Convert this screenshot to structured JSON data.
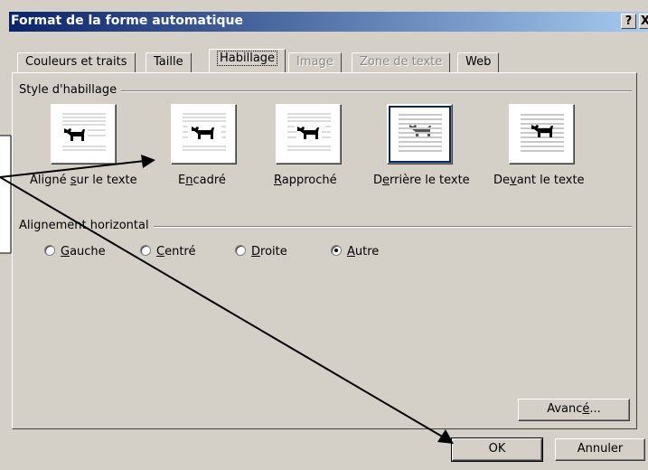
{
  "window": {
    "title": "Format de la forme automatique",
    "help_label": "?",
    "close_label": "X"
  },
  "tabs": [
    {
      "label": "Couleurs et traits",
      "state": "normal"
    },
    {
      "label": "Taille",
      "state": "normal"
    },
    {
      "label": "Habillage",
      "state": "active"
    },
    {
      "label": "Image",
      "state": "disabled"
    },
    {
      "label": "Zone de texte",
      "state": "disabled"
    },
    {
      "label": "Web",
      "state": "normal"
    }
  ],
  "wrap_style": {
    "group_label": "Style d'habillage",
    "options": [
      {
        "pre": "Aligné ",
        "u": "s",
        "post": "ur le texte",
        "icon": "inline-with-text-icon",
        "selected": false
      },
      {
        "pre": "E",
        "u": "n",
        "post": "cadré",
        "icon": "square-wrap-icon",
        "selected": false
      },
      {
        "pre": "",
        "u": "R",
        "post": "approché",
        "icon": "tight-wrap-icon",
        "selected": false
      },
      {
        "pre": "D",
        "u": "e",
        "post": "rrière le texte",
        "icon": "behind-text-icon",
        "selected": true
      },
      {
        "pre": "De",
        "u": "v",
        "post": "ant le texte",
        "icon": "in-front-of-text-icon",
        "selected": false
      }
    ]
  },
  "horizontal_alignment": {
    "group_label": "Alignement horizontal",
    "options": [
      {
        "pre": "",
        "u": "G",
        "post": "auche",
        "checked": false
      },
      {
        "pre": "",
        "u": "C",
        "post": "entré",
        "checked": false
      },
      {
        "pre": "",
        "u": "D",
        "post": "roite",
        "checked": false
      },
      {
        "pre": "",
        "u": "A",
        "post": "utre",
        "checked": true
      }
    ]
  },
  "buttons": {
    "advanced": {
      "pre": "Avanc",
      "u": "é",
      "post": "..."
    },
    "ok": "OK",
    "cancel": "Annuler"
  },
  "colors": {
    "title_gradient_start": "#0a246a",
    "title_gradient_end": "#a6caf0",
    "dialog_face": "#d4d0c8",
    "selection_border": "#0a246a"
  }
}
